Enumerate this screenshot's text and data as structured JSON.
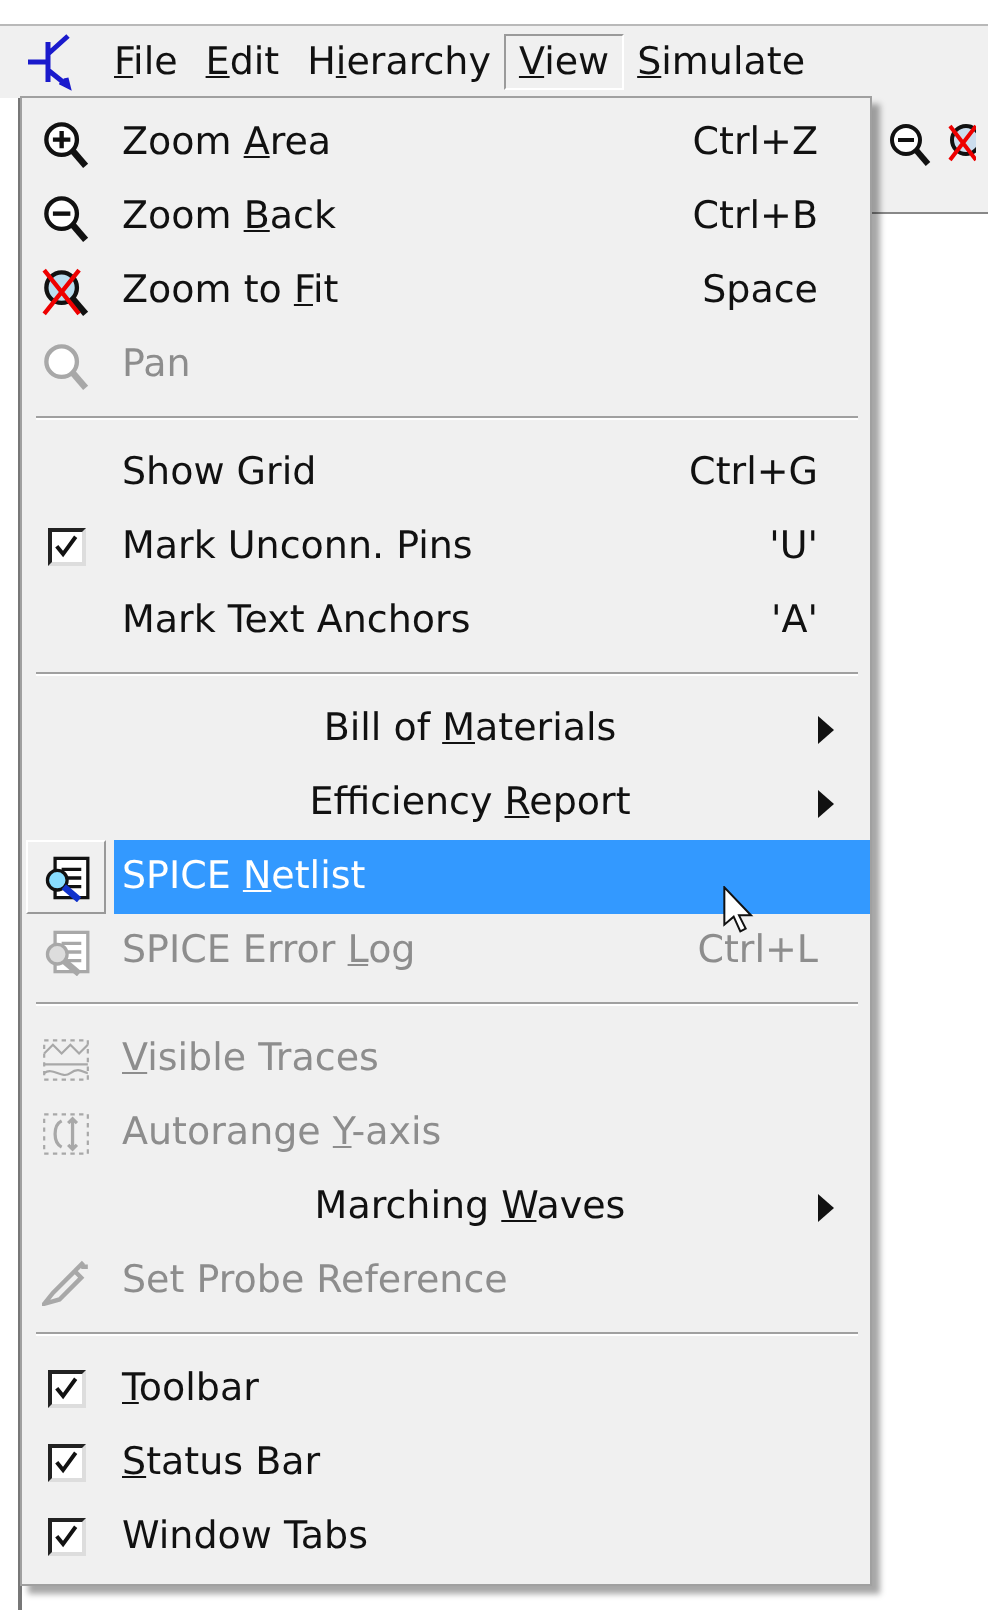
{
  "menubar": [
    {
      "label": {
        "key": "F",
        "after": "ile"
      },
      "selected": false
    },
    {
      "label": {
        "key": "E",
        "after": "dit"
      },
      "selected": false
    },
    {
      "label": {
        "before": "H",
        "key": "i",
        "after": "erarchy"
      },
      "selected": false
    },
    {
      "label": {
        "key": "V",
        "after": "iew"
      },
      "selected": true
    },
    {
      "label": {
        "key": "S",
        "after": "imulate"
      },
      "selected": false
    }
  ],
  "menu": [
    {
      "kind": "item",
      "label": {
        "before": "Zoom ",
        "key": "A",
        "after": "rea"
      },
      "shortcut": "Ctrl+Z",
      "disabled": false,
      "selected": false
    },
    {
      "kind": "item",
      "label": {
        "before": "Zoom ",
        "key": "B",
        "after": "ack"
      },
      "shortcut": "Ctrl+B",
      "disabled": false,
      "selected": false
    },
    {
      "kind": "item",
      "label": {
        "before": "Zoom to ",
        "key": "F",
        "after": "it"
      },
      "shortcut": "Space",
      "disabled": false,
      "selected": false
    },
    {
      "kind": "item",
      "label": {
        "before": "Pan"
      },
      "disabled": true,
      "selected": false
    },
    {
      "kind": "separator"
    },
    {
      "kind": "item",
      "label": {
        "before": "Show Grid"
      },
      "shortcut": "Ctrl+G",
      "checked": false,
      "disabled": false,
      "selected": false
    },
    {
      "kind": "item",
      "label": {
        "before": "Mark Unconn. Pins"
      },
      "shortcut": "'U'",
      "checked": true,
      "disabled": false,
      "selected": false
    },
    {
      "kind": "item",
      "label": {
        "before": "Mark Text Anchors"
      },
      "shortcut": "'A'",
      "checked": false,
      "disabled": false,
      "selected": false
    },
    {
      "kind": "separator"
    },
    {
      "kind": "submenu",
      "label": {
        "before": "Bill of ",
        "key": "M",
        "after": "aterials"
      }
    },
    {
      "kind": "submenu",
      "label": {
        "before": "Efficiency ",
        "key": "R",
        "after": "eport"
      }
    },
    {
      "kind": "item",
      "label": {
        "before": "SPICE ",
        "key": "N",
        "after": "etlist"
      },
      "disabled": false,
      "selected": true
    },
    {
      "kind": "item",
      "label": {
        "before": "SPICE Error ",
        "key": "L",
        "after": "og"
      },
      "shortcut": "Ctrl+L",
      "disabled": true,
      "selected": false
    },
    {
      "kind": "separator"
    },
    {
      "kind": "item",
      "label": {
        "key": "V",
        "after": "isible Traces"
      },
      "disabled": true,
      "selected": false
    },
    {
      "kind": "item",
      "label": {
        "before": "Autorange ",
        "key": "Y",
        "after": "-axis"
      },
      "disabled": true,
      "selected": false
    },
    {
      "kind": "submenu",
      "label": {
        "before": "Marching ",
        "key": "W",
        "after": "aves"
      }
    },
    {
      "kind": "item",
      "label": {
        "before": "Set Probe Reference"
      },
      "disabled": true,
      "selected": false
    },
    {
      "kind": "separator"
    },
    {
      "kind": "item",
      "label": {
        "key": "T",
        "after": "oolbar"
      },
      "checked": true,
      "disabled": false,
      "selected": false
    },
    {
      "kind": "item",
      "label": {
        "key": "S",
        "after": "tatus Bar"
      },
      "checked": true,
      "disabled": false,
      "selected": false
    },
    {
      "kind": "item",
      "label": {
        "before": "Window Tabs"
      },
      "checked": true,
      "disabled": false,
      "selected": false
    }
  ]
}
